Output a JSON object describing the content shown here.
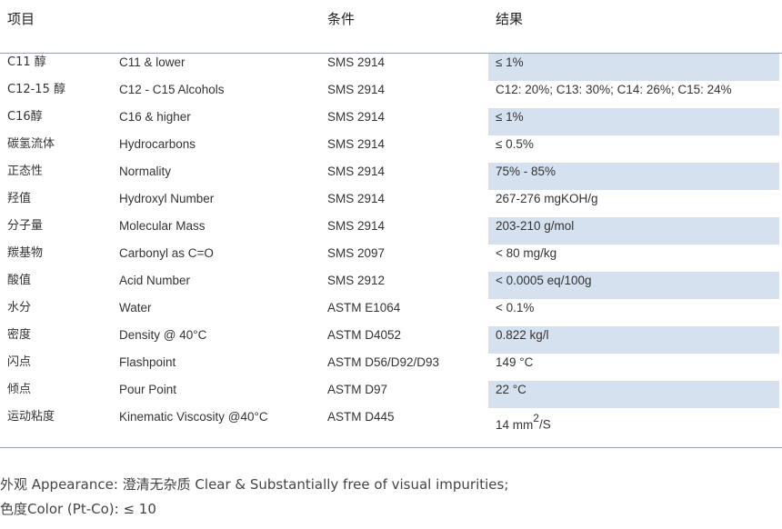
{
  "headers": {
    "item": "项目",
    "condition": "条件",
    "result": "结果"
  },
  "rows": [
    {
      "zh": "C11 醇",
      "en": "C11 & lower",
      "method": "SMS 2914",
      "result": "≤ 1%",
      "shaded": true
    },
    {
      "zh": "C12-15 醇",
      "en": "C12 - C15 Alcohols",
      "method": "SMS 2914",
      "result": "C12: 20%;  C13: 30%;  C14: 26%;  C15: 24%",
      "shaded": false
    },
    {
      "zh": "C16醇",
      "en": "C16 & higher",
      "method": "SMS 2914",
      "result": "≤ 1%",
      "shaded": true
    },
    {
      "zh": "碳氢流体",
      "en": "Hydrocarbons",
      "method": "SMS 2914",
      "result": "≤ 0.5%",
      "shaded": false
    },
    {
      "zh": "正态性",
      "en": "Normality",
      "method": "SMS 2914",
      "result": " 75% - 85%",
      "shaded": true
    },
    {
      "zh": "羟值",
      "en": "Hydroxyl Number",
      "method": "SMS 2914",
      "result": "267-276 mgKOH/g",
      "shaded": false
    },
    {
      "zh": "分子量",
      "en": "Molecular Mass",
      "method": "SMS 2914",
      "result": "203-210 g/mol",
      "shaded": true
    },
    {
      "zh": "羰基物",
      "en": "Carbonyl as C=O",
      "method": "SMS 2097",
      "result": "< 80 mg/kg",
      "shaded": false
    },
    {
      "zh": "酸值",
      "en": "Acid Number",
      "method": "SMS 2912",
      "result": "< 0.0005 eq/100g",
      "shaded": true
    },
    {
      "zh": "水分",
      "en": "Water",
      "method": "ASTM E1064",
      "result": "< 0.1%",
      "shaded": false
    },
    {
      "zh": "密度",
      "en": "Density @ 40°C",
      "method": "ASTM D4052",
      "result": "0.822 kg/l",
      "shaded": true
    },
    {
      "zh": "闪点",
      "en": "Flashpoint",
      "method": "ASTM D56/D92/D93",
      "result": "149 °C",
      "shaded": false
    },
    {
      "zh": "倾点",
      "en": "Pour Point",
      "method": "ASTM D97",
      "result": "22 °C",
      "shaded": true
    },
    {
      "zh": "运动粘度",
      "en": "Kinematic Viscosity @40°C",
      "method": "ASTM D445",
      "result": "14 mm",
      "result_sup": "2",
      "result_tail": "/S",
      "shaded": false
    }
  ],
  "notes": [
    "外观 Appearance: 澄清无杂质 Clear & Substantially free of visual impurities;",
    "色度Color (Pt-Co): ≤ 10"
  ],
  "colors": {
    "shade": "#d6e1ef",
    "rule": "#8fa3b8"
  }
}
